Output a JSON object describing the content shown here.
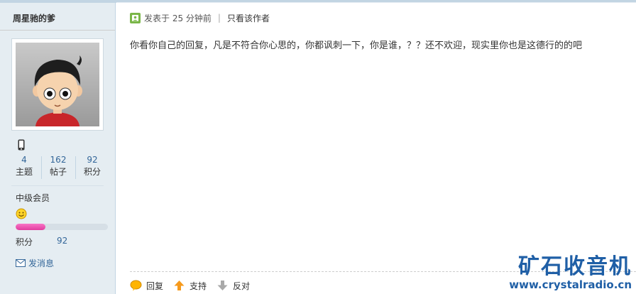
{
  "author": {
    "name": "周星驰的爹",
    "stats": [
      {
        "value": "4",
        "label": "主题"
      },
      {
        "value": "162",
        "label": "帖子"
      },
      {
        "value": "92",
        "label": "积分"
      }
    ],
    "level": "中级会员",
    "points_label": "积分",
    "points_value": "92",
    "progress_fraction": 0.32,
    "send_message": "发消息"
  },
  "post": {
    "posted_time": "发表于 25 分钟前",
    "separator": "|",
    "view_author_only": "只看该作者",
    "content": "你看你自己的回复，凡是不符合你心思的，你都讽刺一下，你是谁，？？还不欢迎，现实里你也是这德行的的吧"
  },
  "actions": {
    "reply": "回复",
    "support": "支持",
    "oppose": "反对"
  },
  "watermark": {
    "title": "矿石收音机",
    "url": "www.crystalradio.cn"
  },
  "colors": {
    "sidebar_bg": "#e5edf2",
    "link": "#336699",
    "progress": "#e13d9f",
    "watermark": "#1f5fa6"
  }
}
